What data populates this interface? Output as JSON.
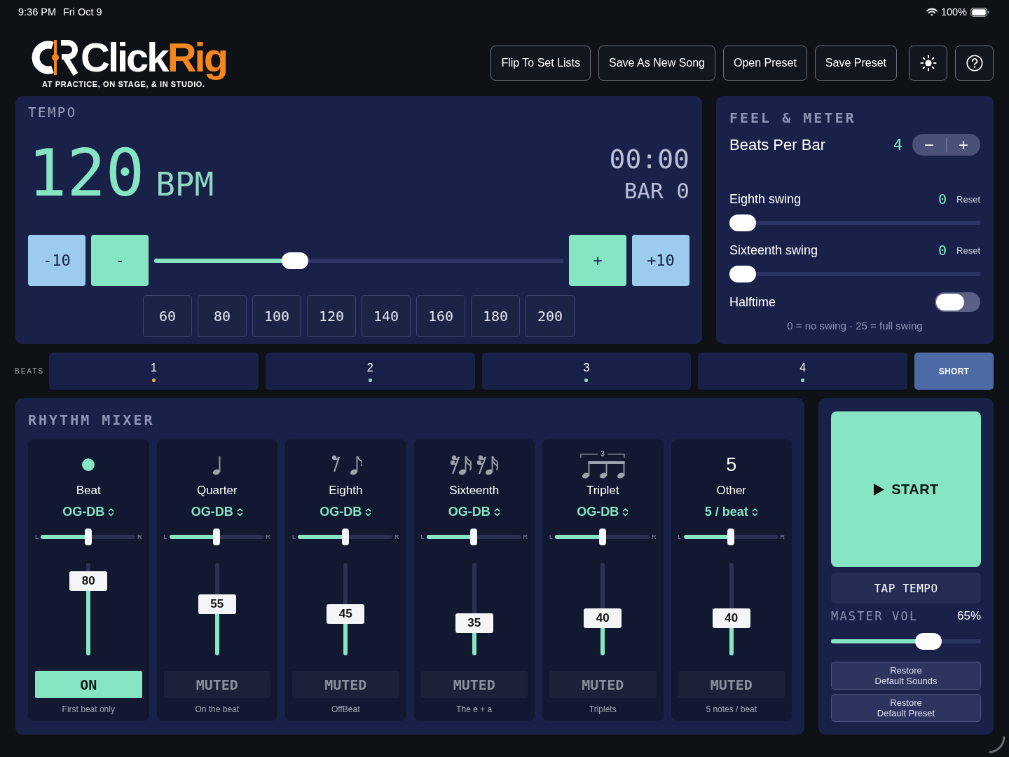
{
  "status_bar": {
    "time": "9:36 PM",
    "date": "Fri Oct 9",
    "battery": "100%"
  },
  "header": {
    "logo": {
      "wordmark": [
        "Click",
        "Rig"
      ],
      "tagline": "AT PRACTICE, ON STAGE, & IN STUDIO."
    },
    "buttons": [
      "Flip To Set Lists",
      "Save As New Song",
      "Open Preset",
      "Save Preset"
    ]
  },
  "tempo": {
    "title": "TEMPO",
    "bpm": "120",
    "unit": "BPM",
    "time": "00:00",
    "bar": "BAR 0",
    "decrease": [
      {
        "label": "-10",
        "kind": "coarse"
      },
      {
        "label": "-",
        "kind": "fine"
      }
    ],
    "slider": {
      "level": 0.345
    },
    "increase": [
      {
        "label": "+",
        "kind": "fine"
      },
      {
        "label": "+10",
        "kind": "coarse"
      }
    ],
    "presets": [
      "60",
      "80",
      "100",
      "120",
      "140",
      "160",
      "180",
      "200"
    ]
  },
  "feel_meter": {
    "title": "FEEL & METER",
    "beats_per_bar": {
      "label": "Beats Per Bar",
      "value": "4",
      "minus": "−",
      "plus": "+"
    },
    "swings": [
      {
        "label": "Eighth swing",
        "value": "0",
        "reset": "Reset",
        "level": 0
      },
      {
        "label": "Sixteenth swing",
        "value": "0",
        "reset": "Reset",
        "level": 0
      }
    ],
    "halftime": {
      "label": "Halftime",
      "on": false
    },
    "note": "0 = no swing · 25 = full swing"
  },
  "beats": {
    "label": "BEATS",
    "items": [
      {
        "number": "1",
        "color": "#f2a65a"
      },
      {
        "number": "2",
        "color": "#86e6c3"
      },
      {
        "number": "3",
        "color": "#86e6c3"
      },
      {
        "number": "4",
        "color": "#86e6c3"
      }
    ],
    "button": "SHORT"
  },
  "rhythm_mixer": {
    "title": "RHYTHM MIXER",
    "channels": [
      {
        "kind": "dot",
        "name": "Beat",
        "sound": "OG-DB",
        "pan": {
          "left": "L",
          "right": "R",
          "level": 0.5
        },
        "volume": {
          "level": 0.8,
          "reading": "80"
        },
        "toggle": {
          "label": "ON",
          "on": true
        },
        "description": "First beat only"
      },
      {
        "kind": "quarter",
        "name": "Quarter",
        "sound": "OG-DB",
        "pan": {
          "left": "L",
          "right": "R",
          "level": 0.5
        },
        "volume": {
          "level": 0.55,
          "reading": "55"
        },
        "toggle": {
          "label": "MUTED",
          "on": false
        },
        "description": "On the beat"
      },
      {
        "kind": "eighth",
        "name": "Eighth",
        "sound": "OG-DB",
        "pan": {
          "left": "L",
          "right": "R",
          "level": 0.5
        },
        "volume": {
          "level": 0.45,
          "reading": "45"
        },
        "toggle": {
          "label": "MUTED",
          "on": false
        },
        "description": "OffBeat"
      },
      {
        "kind": "sixteenth",
        "name": "Sixteenth",
        "sound": "OG-DB",
        "pan": {
          "left": "L",
          "right": "R",
          "level": 0.5
        },
        "volume": {
          "level": 0.35,
          "reading": "35"
        },
        "toggle": {
          "label": "MUTED",
          "on": false
        },
        "description": "The e + a"
      },
      {
        "kind": "triplet",
        "tuplet": "3",
        "name": "Triplet",
        "sound": "OG-DB",
        "pan": {
          "left": "L",
          "right": "R",
          "level": 0.5
        },
        "volume": {
          "level": 0.4,
          "reading": "40"
        },
        "toggle": {
          "label": "MUTED",
          "on": false
        },
        "description": "Triplets"
      },
      {
        "kind": "number",
        "symbol": "5",
        "name": "Other",
        "sound": "5 / beat",
        "pan": {
          "left": "L",
          "right": "R",
          "level": 0.5
        },
        "volume": {
          "level": 0.4,
          "reading": "40"
        },
        "toggle": {
          "label": "MUTED",
          "on": false
        },
        "description": "5 notes / beat"
      }
    ]
  },
  "transport": {
    "start": "START",
    "tap": "TAP TEMPO",
    "master": {
      "label": "MASTER VOL",
      "reading": "65%",
      "level": 0.65
    },
    "restore": [
      "Restore\nDefault Sounds",
      "Restore\nDefault Preset"
    ]
  }
}
